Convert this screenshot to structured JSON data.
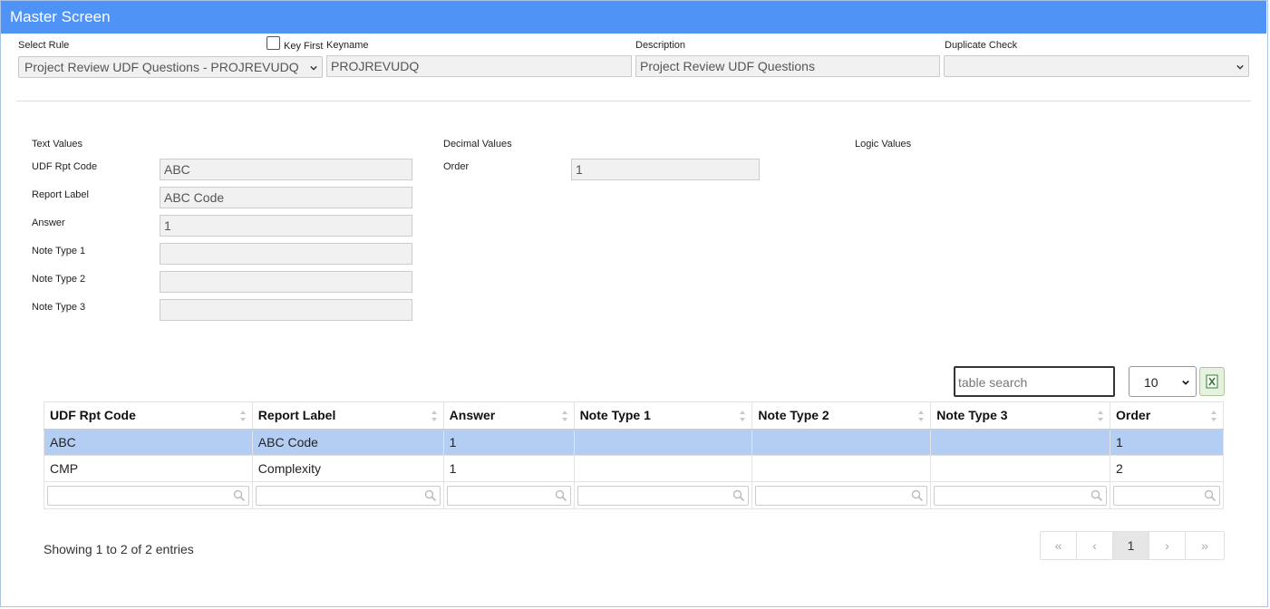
{
  "window": {
    "title": "Master Screen"
  },
  "header": {
    "select_rule_label": "Select Rule",
    "select_rule_value": "Project Review UDF Questions - PROJREVUDQ",
    "key_first_label": "Key First",
    "key_first_checked": false,
    "keyname_label": "Keyname",
    "keyname_value": "PROJREVUDQ",
    "description_label": "Description",
    "description_value": "Project Review UDF Questions",
    "duplicate_check_label": "Duplicate Check",
    "duplicate_check_value": ""
  },
  "sections": {
    "text_values": "Text Values",
    "decimal_values": "Decimal Values",
    "logic_values": "Logic Values"
  },
  "text_fields": {
    "udf_rpt_code": {
      "label": "UDF Rpt Code",
      "value": "ABC"
    },
    "report_label": {
      "label": "Report Label",
      "value": "ABC Code"
    },
    "answer": {
      "label": "Answer",
      "value": "1"
    },
    "note_type_1": {
      "label": "Note Type 1",
      "value": ""
    },
    "note_type_2": {
      "label": "Note Type 2",
      "value": ""
    },
    "note_type_3": {
      "label": "Note Type 3",
      "value": ""
    }
  },
  "decimal_fields": {
    "order": {
      "label": "Order",
      "value": "1"
    }
  },
  "table_controls": {
    "search_placeholder": "table search",
    "page_size": "10"
  },
  "table": {
    "columns": [
      "UDF Rpt Code",
      "Report Label",
      "Answer",
      "Note Type 1",
      "Note Type 2",
      "Note Type 3",
      "Order"
    ],
    "rows": [
      [
        "ABC",
        "ABC Code",
        "1",
        "",
        "",
        "",
        "1"
      ],
      [
        "CMP",
        "Complexity",
        "1",
        "",
        "",
        "",
        "2"
      ]
    ],
    "selected_row": 0
  },
  "footer": {
    "showing_text": "Showing 1 to 2 of 2 entries",
    "pager": {
      "first": "«",
      "prev": "‹",
      "current": "1",
      "next": "›",
      "last": "»"
    }
  },
  "colors": {
    "titlebar": "#4e93f5",
    "selected_row": "#b4cdf3"
  }
}
